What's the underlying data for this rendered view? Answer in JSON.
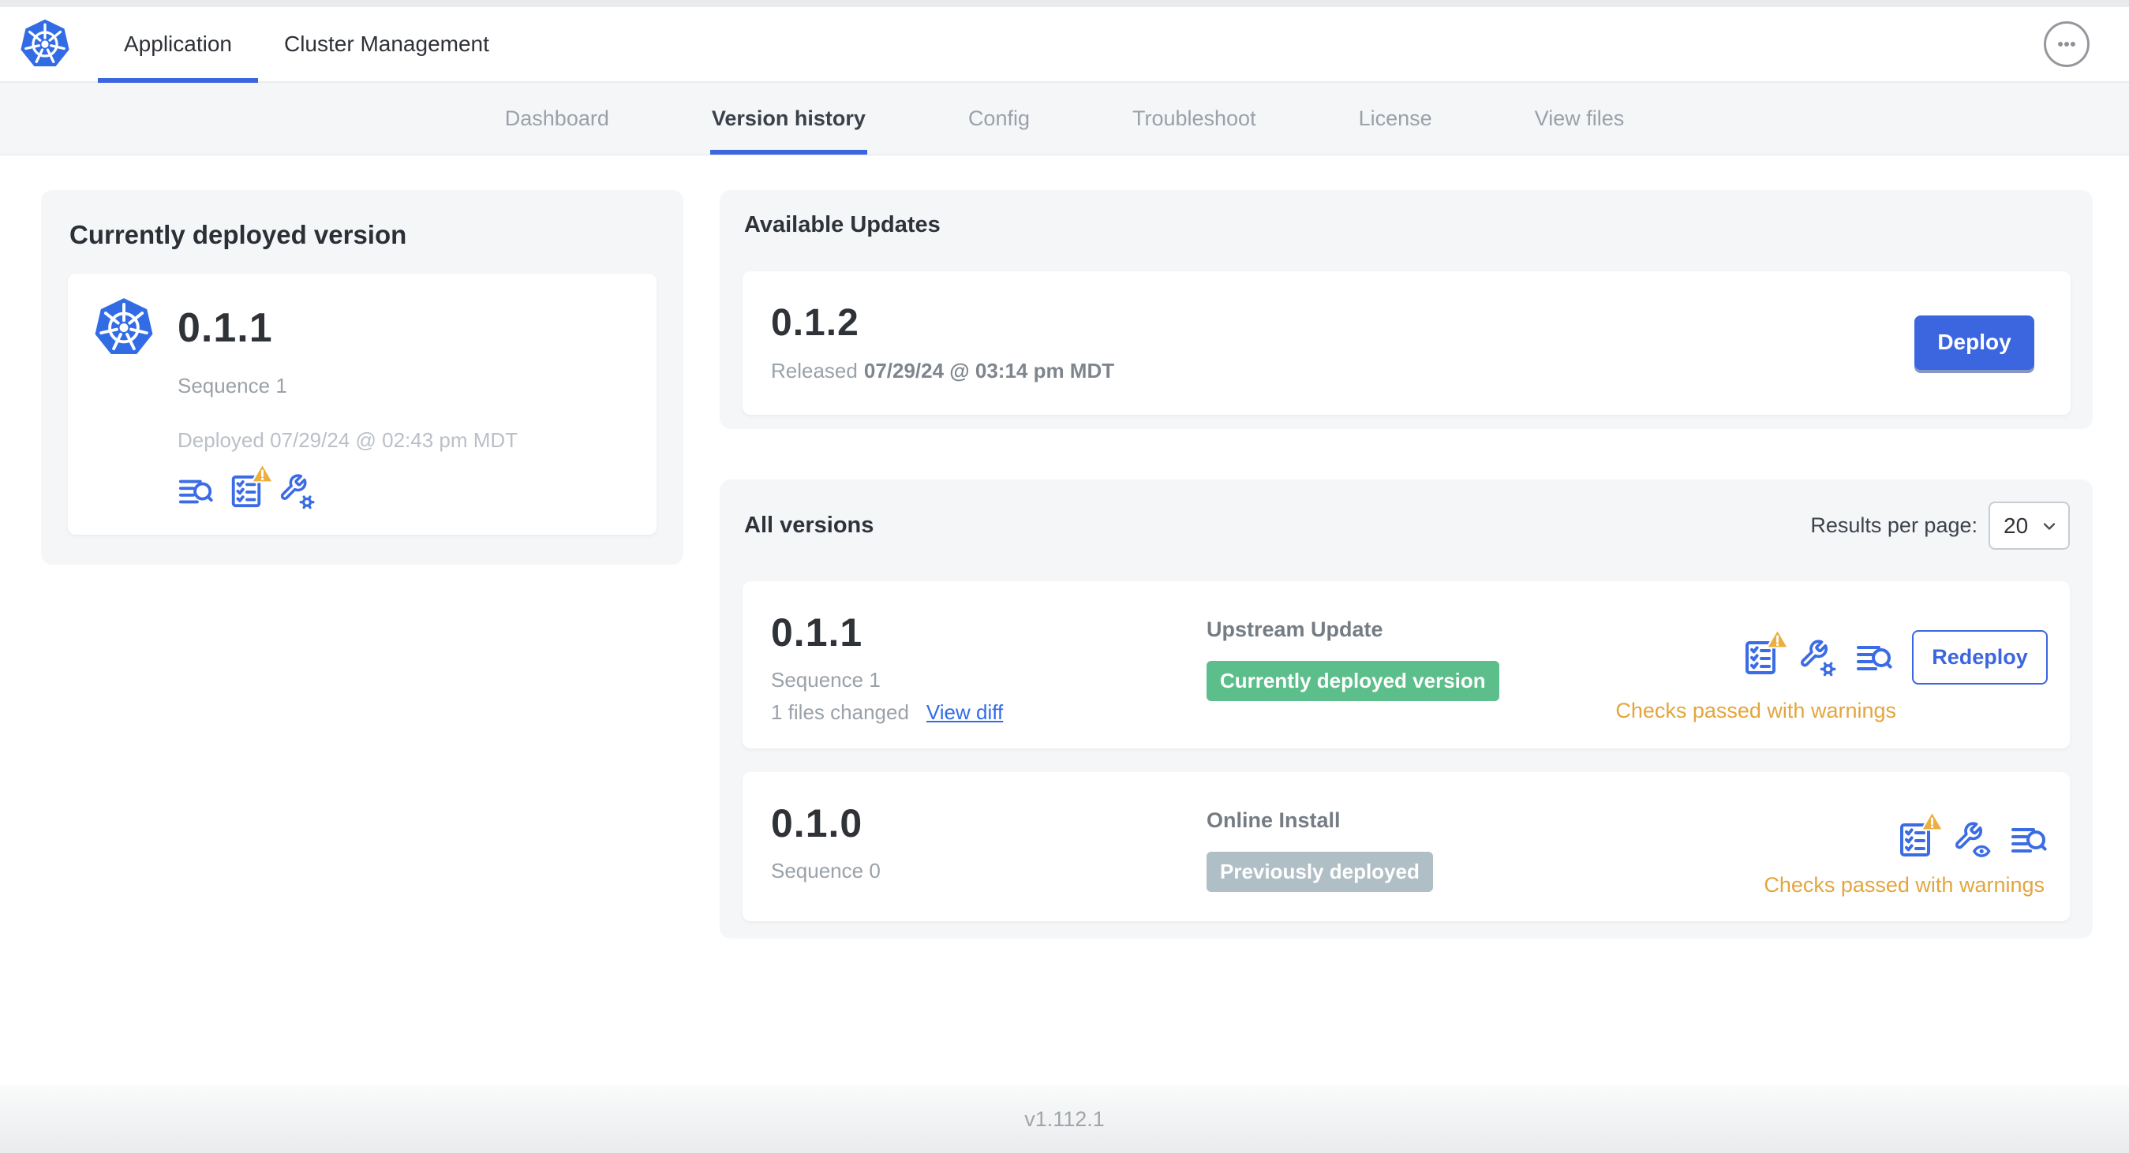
{
  "colors": {
    "accent": "#3c66e0",
    "k8s_blue": "#326ce5",
    "success": "#5cbe8a",
    "muted_badge": "#b0bfc5",
    "warning": "#e3a53d"
  },
  "topnav": {
    "tabs": [
      {
        "label": "Application",
        "active": true
      },
      {
        "label": "Cluster Management",
        "active": false
      }
    ],
    "menu_icon": "ellipsis-icon"
  },
  "subnav": {
    "items": [
      {
        "label": "Dashboard",
        "active": false
      },
      {
        "label": "Version history",
        "active": true
      },
      {
        "label": "Config",
        "active": false
      },
      {
        "label": "Troubleshoot",
        "active": false
      },
      {
        "label": "License",
        "active": false
      },
      {
        "label": "View files",
        "active": false
      }
    ]
  },
  "current_version": {
    "title": "Currently deployed version",
    "version": "0.1.1",
    "sequence": "Sequence 1",
    "deployed": "Deployed 07/29/24 @ 02:43 pm MDT",
    "icons": [
      "file-diff-icon",
      "preflight-checks-warning-icon",
      "edit-config-icon"
    ]
  },
  "available_updates": {
    "title": "Available Updates",
    "version": "0.1.2",
    "released_label": "Released",
    "released_date": "07/29/24 @ 03:14 pm MDT",
    "deploy_label": "Deploy"
  },
  "all_versions": {
    "title": "All versions",
    "results_per_page_label": "Results per page:",
    "results_per_page_value": "20",
    "rows": [
      {
        "version": "0.1.1",
        "sequence": "Sequence 1",
        "files_changed": "1 files changed",
        "view_diff_label": "View diff",
        "source": "Upstream Update",
        "badge": "Currently deployed version",
        "badge_style": "success",
        "action_label": "Redeploy",
        "status": "Checks passed with warnings",
        "icons": [
          "preflight-checks-warning-icon",
          "edit-config-icon",
          "file-diff-icon"
        ]
      },
      {
        "version": "0.1.0",
        "sequence": "Sequence 0",
        "source": "Online Install",
        "badge": "Previously deployed",
        "badge_style": "muted",
        "status": "Checks passed with warnings",
        "icons": [
          "preflight-checks-warning-icon",
          "view-config-icon",
          "file-diff-icon"
        ]
      }
    ]
  },
  "footer": {
    "version": "v1.112.1"
  }
}
